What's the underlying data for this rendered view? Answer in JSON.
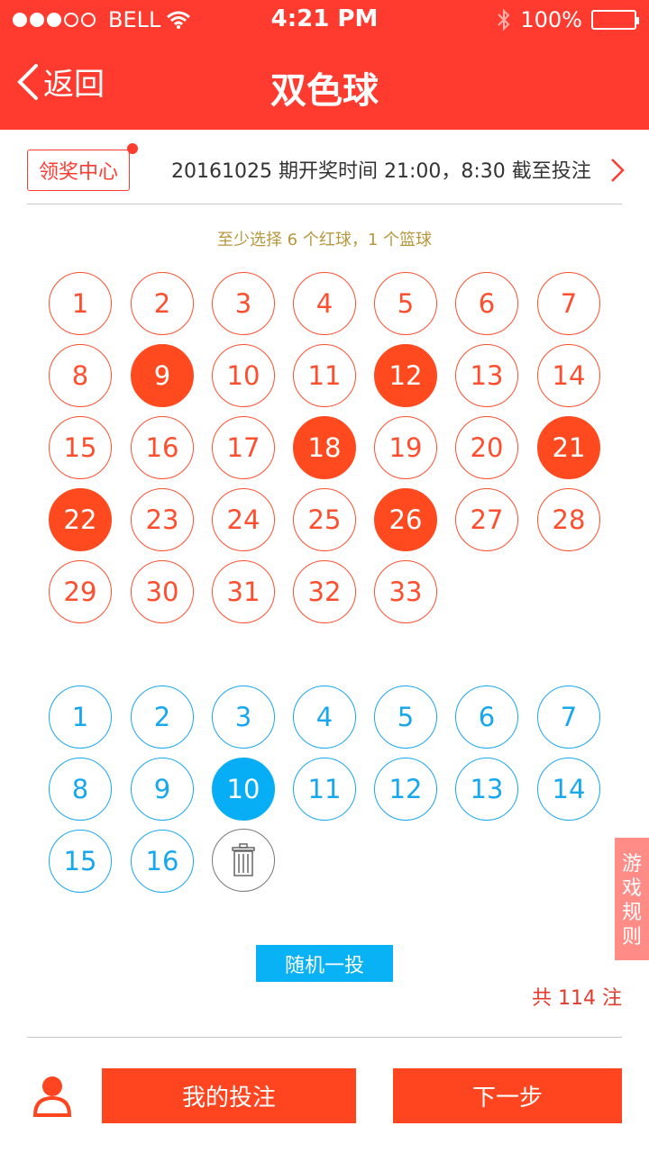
{
  "status": {
    "carrier": "BELL",
    "time": "4:21 PM",
    "battery": "100%"
  },
  "nav": {
    "back_label": "返回",
    "title": "双色球"
  },
  "info": {
    "prize_center": "领奖中心",
    "period_text": "20161025 期开奖时间 21:00，8:30 截至投注"
  },
  "hint": "至少选择 6 个红球，1 个篮球",
  "red_balls": [
    {
      "n": "1",
      "sel": false
    },
    {
      "n": "2",
      "sel": false
    },
    {
      "n": "3",
      "sel": false
    },
    {
      "n": "4",
      "sel": false
    },
    {
      "n": "5",
      "sel": false
    },
    {
      "n": "6",
      "sel": false
    },
    {
      "n": "7",
      "sel": false
    },
    {
      "n": "8",
      "sel": false
    },
    {
      "n": "9",
      "sel": true
    },
    {
      "n": "10",
      "sel": false
    },
    {
      "n": "11",
      "sel": false
    },
    {
      "n": "12",
      "sel": true
    },
    {
      "n": "13",
      "sel": false
    },
    {
      "n": "14",
      "sel": false
    },
    {
      "n": "15",
      "sel": false
    },
    {
      "n": "16",
      "sel": false
    },
    {
      "n": "17",
      "sel": false
    },
    {
      "n": "18",
      "sel": true
    },
    {
      "n": "19",
      "sel": false
    },
    {
      "n": "20",
      "sel": false
    },
    {
      "n": "21",
      "sel": true
    },
    {
      "n": "22",
      "sel": true
    },
    {
      "n": "23",
      "sel": false
    },
    {
      "n": "24",
      "sel": false
    },
    {
      "n": "25",
      "sel": false
    },
    {
      "n": "26",
      "sel": true
    },
    {
      "n": "27",
      "sel": false
    },
    {
      "n": "28",
      "sel": false
    },
    {
      "n": "29",
      "sel": false
    },
    {
      "n": "30",
      "sel": false
    },
    {
      "n": "31",
      "sel": false
    },
    {
      "n": "32",
      "sel": false
    },
    {
      "n": "33",
      "sel": false
    }
  ],
  "blue_balls": [
    {
      "n": "1",
      "sel": false
    },
    {
      "n": "2",
      "sel": false
    },
    {
      "n": "3",
      "sel": false
    },
    {
      "n": "4",
      "sel": false
    },
    {
      "n": "5",
      "sel": false
    },
    {
      "n": "6",
      "sel": false
    },
    {
      "n": "7",
      "sel": false
    },
    {
      "n": "8",
      "sel": false
    },
    {
      "n": "9",
      "sel": false
    },
    {
      "n": "10",
      "sel": true
    },
    {
      "n": "11",
      "sel": false
    },
    {
      "n": "12",
      "sel": false
    },
    {
      "n": "13",
      "sel": false
    },
    {
      "n": "14",
      "sel": false
    },
    {
      "n": "15",
      "sel": false
    },
    {
      "n": "16",
      "sel": false
    }
  ],
  "random_button": "随机一投",
  "total_text": "共 114 注",
  "rules_tab": "游戏规则",
  "buttons": {
    "my_bets": "我的投注",
    "next": "下一步"
  },
  "colors": {
    "header": "#ff3b30",
    "red_ball": "#ff4a1f",
    "blue_ball": "#07aef6"
  },
  "icons": {
    "back": "chevron-left-icon",
    "trash": "trash-icon",
    "user": "user-icon",
    "arrow": "chevron-right-icon"
  }
}
